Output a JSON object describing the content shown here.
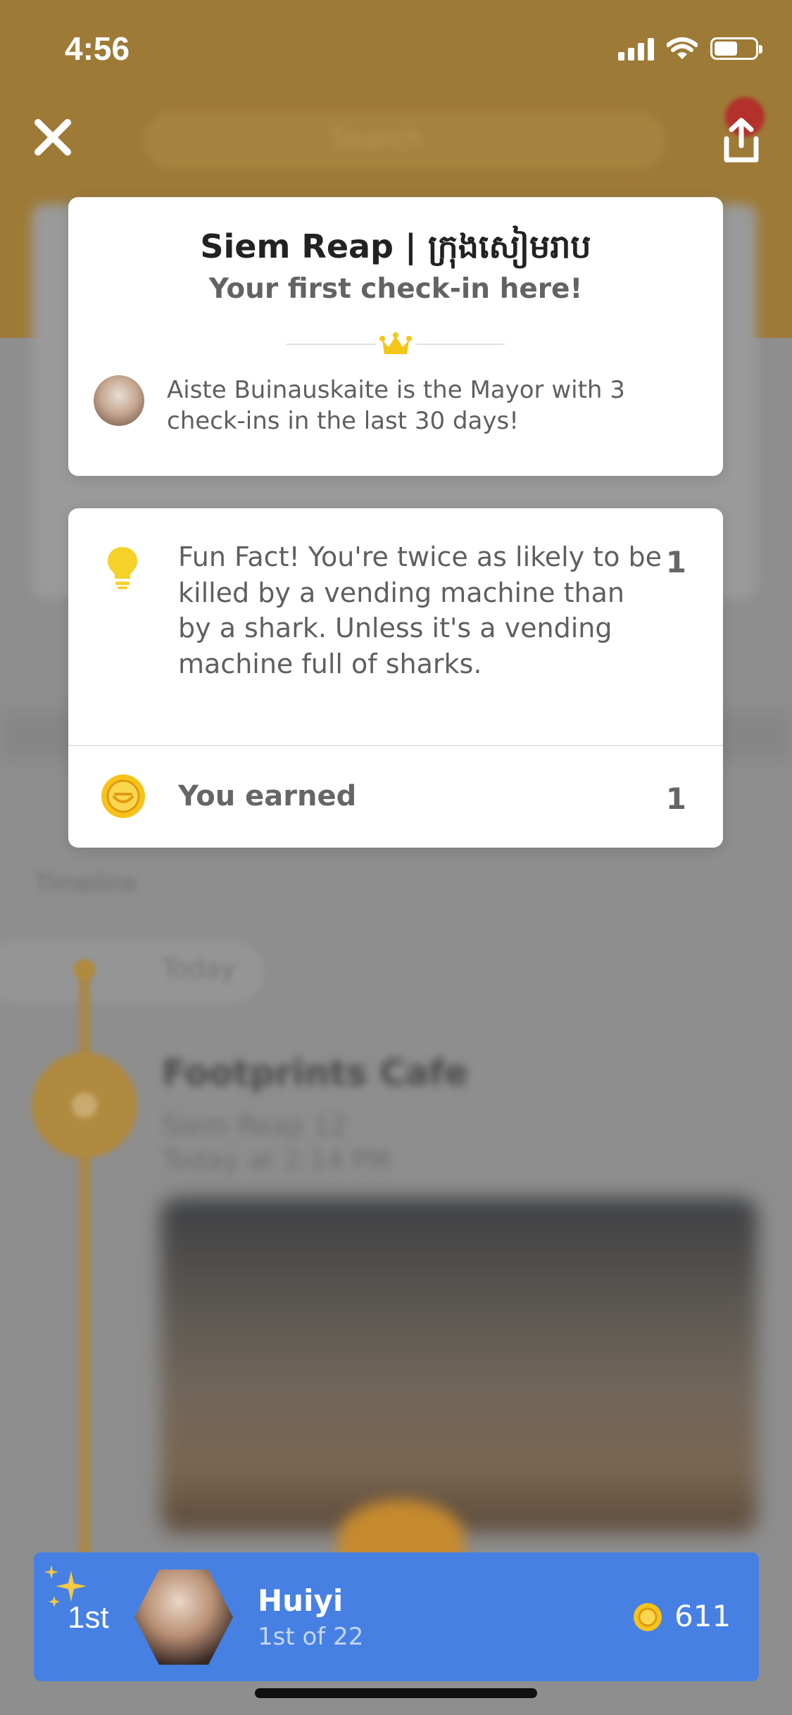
{
  "status_bar": {
    "time": "4:56"
  },
  "venue_card": {
    "title": "Siem Reap | ក្រុងសៀមរាប",
    "subtitle": "Your first check-in here!",
    "mayor_text": "Aiste Buinauskaite is the Mayor with 3 check-ins in the last 30 days!",
    "crown_icon": "crown-icon"
  },
  "facts_card": {
    "fun_fact": "Fun Fact! You're twice as likely to be killed by a vending machine than by a shark. Unless it's a vending machine full of sharks.",
    "fun_fact_count": "1",
    "earned_label": "You earned",
    "earned_count": "1",
    "fact_icon": "lightbulb-icon",
    "earned_icon": "coin-icon"
  },
  "background": {
    "search_placeholder": "Search",
    "timeline_label": "Timeline",
    "today_label": "Today",
    "venue_name": "Footprints Cafe",
    "venue_location": "Siem Reap",
    "venue_coins": "12",
    "venue_time": "Today at 2:14 PM"
  },
  "leaderboard": {
    "rank": "1st",
    "name": "Huiyi",
    "rank_detail": "1st of 22",
    "coins": "611"
  },
  "colors": {
    "header_gold": "#9e7a37",
    "leader_blue": "#4680e3",
    "coin_yellow": "#f5c518",
    "card_white": "#ffffff"
  }
}
